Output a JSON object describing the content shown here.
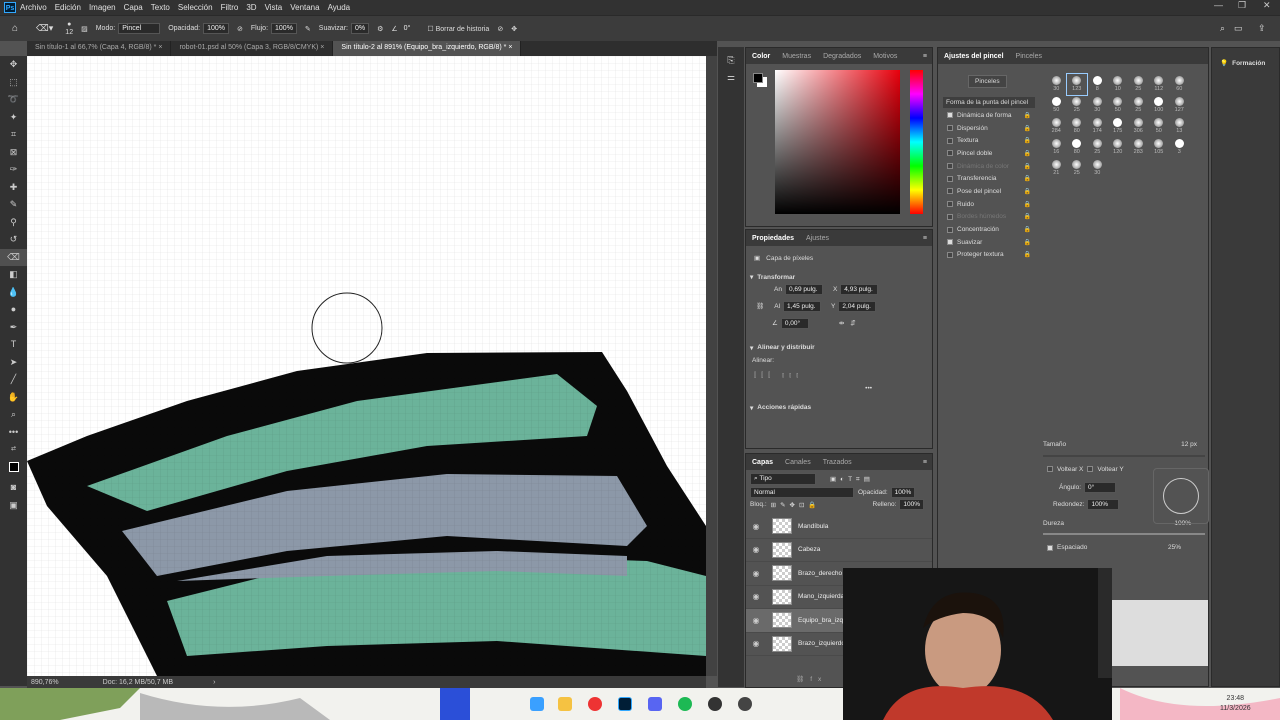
{
  "app": {
    "logo": "Ps"
  },
  "menu": [
    "Archivo",
    "Edición",
    "Imagen",
    "Capa",
    "Texto",
    "Selección",
    "Filtro",
    "3D",
    "Vista",
    "Ventana",
    "Ayuda"
  ],
  "options": {
    "brush_size": "12",
    "mode_label": "Modo:",
    "mode": "Pincel",
    "opacity_label": "Opacidad:",
    "opacity": "100%",
    "flow_label": "Flujo:",
    "flow": "100%",
    "smooth_label": "Suavizar:",
    "smooth": "0%",
    "angle": "0°",
    "erase_history": "Borrar de historia"
  },
  "tabs": [
    "Sin título-1 al 66,7% (Capa 4, RGB/8) *",
    "robot-01.psd al 50% (Capa 3, RGB/8/CMYK)",
    "Sin título-2 al 891% (Equipo_bra_izquierdo, RGB/8) *"
  ],
  "status": {
    "zoom": "890,76%",
    "doc": "Doc: 16,2 MB/50,7 MB"
  },
  "color_panel": {
    "tabs": [
      "Color",
      "Muestras",
      "Degradados",
      "Motivos"
    ]
  },
  "properties": {
    "tabs": [
      "Propiedades",
      "Ajustes"
    ],
    "layer_type": "Capa de píxeles",
    "transform_title": "Transformar",
    "an_label": "An",
    "an": "0,69 pulg.",
    "x_label": "X",
    "x": "4,93 pulg.",
    "al_label": "Al",
    "al": "1,45 pulg.",
    "y_label": "Y",
    "y": "2,04 pulg.",
    "angle": "0,00°",
    "align_title": "Alinear y distribuir",
    "align_label": "Alinear:",
    "quick_title": "Acciones rápidas"
  },
  "layers": {
    "tabs": [
      "Capas",
      "Canales",
      "Trazados"
    ],
    "filter": "Tipo",
    "blend": "Normal",
    "opacity_label": "Opacidad:",
    "opacity": "100%",
    "lock_label": "Bloq.:",
    "fill_label": "Relleno:",
    "fill": "100%",
    "items": [
      "Mandíbula",
      "Cabeza",
      "Brazo_derecho",
      "Mano_izquierda",
      "Equipo_bra_izqu",
      "Brazo_izquierdo"
    ]
  },
  "brush_settings": {
    "tabs": [
      "Ajustes del pincel",
      "Pinceles"
    ],
    "brushes_button": "Pinceles",
    "tip_shape": "Forma de la punta del pincel",
    "options": [
      {
        "label": "Dinámica de forma",
        "on": true
      },
      {
        "label": "Dispersión",
        "on": false
      },
      {
        "label": "Textura",
        "on": false
      },
      {
        "label": "Pincel doble",
        "on": false
      },
      {
        "label": "Dinámica de color",
        "on": false,
        "dim": true
      },
      {
        "label": "Transferencia",
        "on": false
      },
      {
        "label": "Pose del pincel",
        "on": false
      },
      {
        "label": "Ruido",
        "on": false
      },
      {
        "label": "Bordes húmedos",
        "on": false,
        "dim": true
      },
      {
        "label": "Concentración",
        "on": false
      },
      {
        "label": "Suavizar",
        "on": true
      },
      {
        "label": "Proteger textura",
        "on": false
      }
    ],
    "sizes": [
      "30",
      "123",
      "8",
      "10",
      "25",
      "112",
      "60",
      "50",
      "25",
      "30",
      "50",
      "25",
      "100",
      "127",
      "284",
      "80",
      "174",
      "175",
      "306",
      "50",
      "13",
      "16",
      "80",
      "25",
      "120",
      "283",
      "105",
      "3",
      "21",
      "25",
      "30"
    ],
    "size_label": "Tamaño",
    "size": "12 px",
    "flip_x": "Voltear X",
    "flip_y": "Voltear Y",
    "angle_label": "Ángulo:",
    "angle": "0°",
    "round_label": "Redondez:",
    "round": "100%",
    "hardness_label": "Dureza",
    "hardness": "100%",
    "spacing_label": "Espaciado",
    "spacing": "25%"
  },
  "learn": {
    "label": "Formación"
  },
  "clock": {
    "time": "23:48",
    "date": "11/3/2026"
  }
}
